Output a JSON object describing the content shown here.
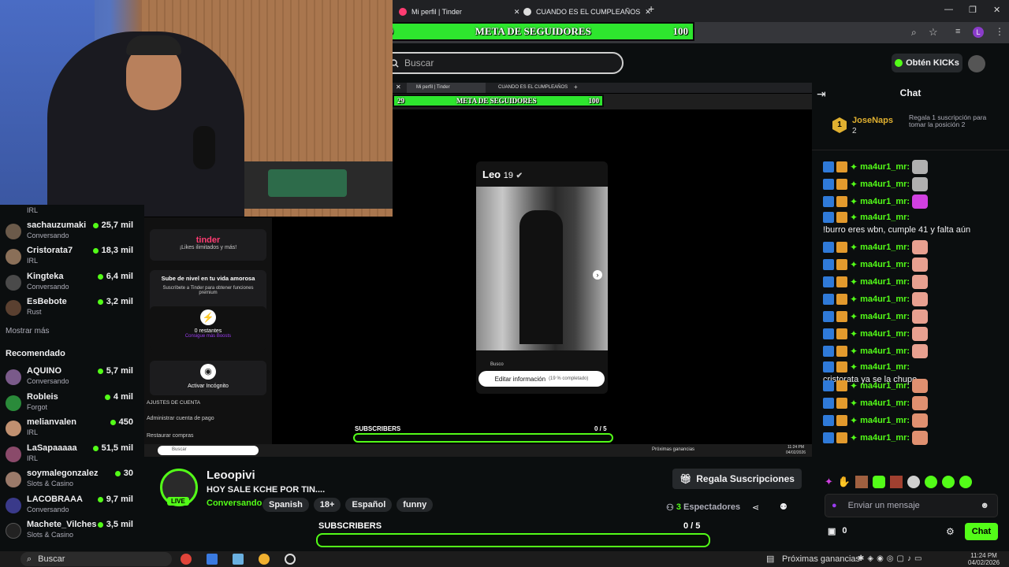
{
  "browser": {
    "tabs": [
      {
        "label": "Mi perfil | Tinder"
      },
      {
        "label": "CUANDO ES EL CUMPLEAÑOS"
      }
    ],
    "goal": {
      "left": "29",
      "title": "META DE SEGUIDORES",
      "right": "100"
    }
  },
  "kick": {
    "search_placeholder": "Buscar",
    "kicks_button": "Obtén KICKs"
  },
  "sidebar": {
    "channels": [
      {
        "category": "IRL"
      },
      {
        "name": "sachauzumaki",
        "category": "Conversando",
        "viewers": "25,7 mil",
        "color": "#6b5a4a"
      },
      {
        "name": "Cristorata7",
        "category": "IRL",
        "viewers": "18,3 mil",
        "color": "#8a6f58"
      },
      {
        "name": "Kingteka",
        "category": "Conversando",
        "viewers": "6,4 mil",
        "color": "#4a4a4a"
      },
      {
        "name": "EsBebote",
        "category": "Rust",
        "viewers": "3,2 mil",
        "color": "#5a4030"
      }
    ],
    "show_more": "Mostrar más",
    "recommended_title": "Recomendado",
    "recommended": [
      {
        "name": "AQUINO",
        "category": "Conversando",
        "viewers": "5,7 mil",
        "color": "#7a5a8a"
      },
      {
        "name": "Robleis",
        "category": "Forgot",
        "viewers": "4 mil",
        "color": "#2a8a3a"
      },
      {
        "name": "melianvalen",
        "category": "IRL",
        "viewers": "450",
        "color": "#c09070"
      },
      {
        "name": "LaSapaaaaa",
        "category": "IRL",
        "viewers": "51,5 mil",
        "color": "#8a4a6a"
      },
      {
        "name": "soymalegonzalez",
        "category": "Slots & Casino",
        "viewers": "30",
        "color": "#9a7a6a"
      },
      {
        "name": "LACOBRAAA",
        "category": "Conversando",
        "viewers": "9,7 mil",
        "color": "#3a3a8a"
      },
      {
        "name": "Machete_Vilches",
        "category": "Slots & Casino",
        "viewers": "3,5 mil",
        "color": "#222"
      }
    ]
  },
  "inner": {
    "tabs": [
      "Mi perfil | Tinder",
      "CUANDO ES EL CUMPLEAÑOS"
    ],
    "goal": {
      "left": "29",
      "title": "META DE SEGUIDORES",
      "right": "100"
    },
    "tinder_logo": "tinder",
    "tinder_sub": "¡Likes ilimitados y más!",
    "upgrade_title": "Sube de nivel en tu vida amorosa",
    "upgrade_desc": "Suscríbete a Tinder para obtener funciones premium",
    "boosts_count": "0 restantes",
    "boosts_link": "Consigue más Boosts",
    "incognito": "Activar Incógnito",
    "account_settings": "AJUSTES DE CUENTA",
    "payment": "Administrar cuenta de pago",
    "restore": "Restaurar compras",
    "profile_name": "Leo",
    "profile_age": "19",
    "profile_search": "Busco",
    "edit_info": "Editar información",
    "edit_pct": "(19 % completado)",
    "subscribers_label": "SUBSCRIBERS",
    "subscribers_count": "0 / 5",
    "taskbar_search": "Buscar",
    "taskbar_right": "Próximas ganancias",
    "clock_time": "11:24 PM",
    "clock_date": "04/02/2026"
  },
  "stream": {
    "streamer": "Leoopivi",
    "live": "LIVE",
    "title": "HOY SALE KCHE POR TIN....",
    "category": "Conversando",
    "tags": [
      "Spanish",
      "18+",
      "Español",
      "funny"
    ],
    "gift_button": "Regala Suscripciones",
    "viewers_count": "3",
    "viewers_label": "Espectadores",
    "subscribers_label": "SUBSCRIBERS",
    "subscribers_count": "0 / 5"
  },
  "chat": {
    "title": "Chat",
    "pinned": {
      "rank": "1",
      "user": "JoseNaps",
      "count": "2",
      "text": "Regala 1 suscripción para tomar la posición 2"
    },
    "messages": [
      {
        "user": "ma4ur1_mr:",
        "text": "",
        "emote": "#b0b0b0"
      },
      {
        "user": "ma4ur1_mr:",
        "text": "",
        "emote": "#b0b0b0"
      },
      {
        "user": "ma4ur1_mr:",
        "text": "",
        "emote": "#d040e0"
      },
      {
        "user": "ma4ur1_mr:",
        "text": "!burro eres wbn, cumple 41 y falta aún",
        "emote": ""
      },
      {
        "user": "ma4ur1_mr:",
        "text": "",
        "emote": "#e8a090"
      },
      {
        "user": "ma4ur1_mr:",
        "text": "",
        "emote": "#e8a090"
      },
      {
        "user": "ma4ur1_mr:",
        "text": "",
        "emote": "#e8a090"
      },
      {
        "user": "ma4ur1_mr:",
        "text": "",
        "emote": "#e8a090"
      },
      {
        "user": "ma4ur1_mr:",
        "text": "",
        "emote": "#e8a090"
      },
      {
        "user": "ma4ur1_mr:",
        "text": "",
        "emote": "#e8a090"
      },
      {
        "user": "ma4ur1_mr:",
        "text": "",
        "emote": "#e8a090"
      },
      {
        "user": "ma4ur1_mr:",
        "text": "cristorata ya se la chupo",
        "emote": ""
      },
      {
        "user": "ma4ur1_mr:",
        "text": "",
        "emote": "#e09070"
      },
      {
        "user": "ma4ur1_mr:",
        "text": "",
        "emote": "#e09070"
      },
      {
        "user": "ma4ur1_mr:",
        "text": "",
        "emote": "#e09070"
      },
      {
        "user": "ma4ur1_mr:",
        "text": "",
        "emote": "#e09070"
      }
    ],
    "input_placeholder": "Enviar un mensaje",
    "kicks_count": "0",
    "send_button": "Chat"
  },
  "taskbar": {
    "search": "Buscar",
    "earnings": "Próximas ganancias",
    "time": "11:24 PM",
    "date": "04/02/2026"
  },
  "colors": {
    "kick_green": "#53fc18",
    "goal_green": "#2ee62e",
    "bg": "#0b0e0f"
  }
}
